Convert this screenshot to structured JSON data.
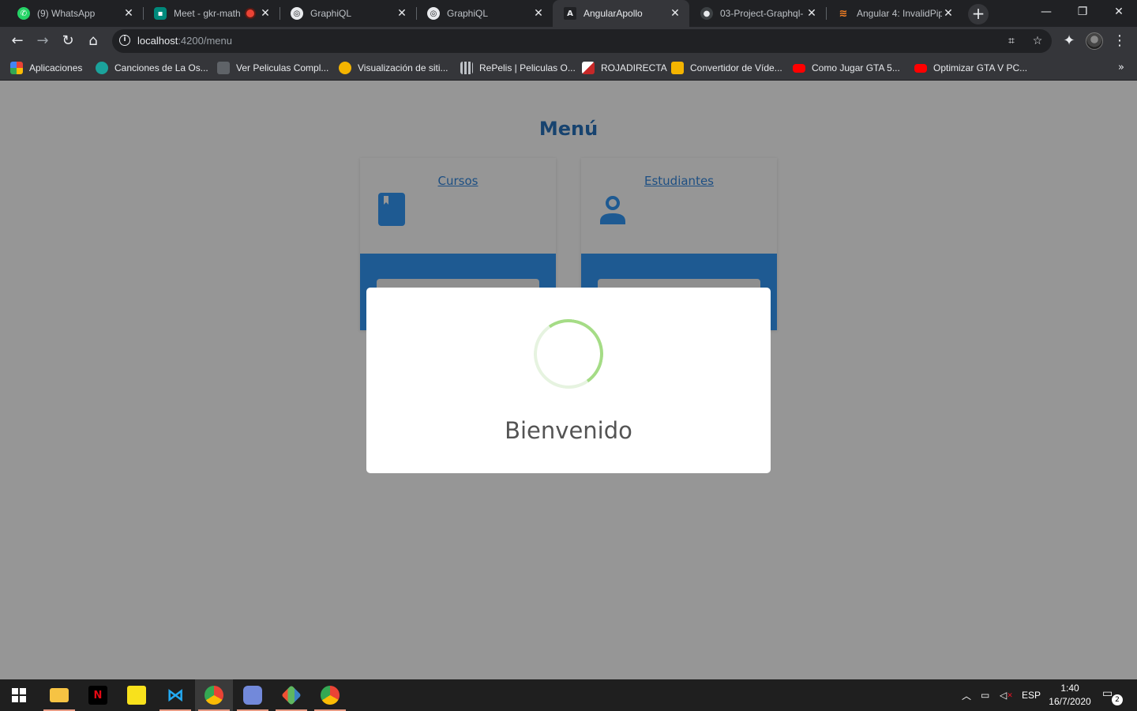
{
  "browser": {
    "tabs": [
      {
        "title": "(9) WhatsApp",
        "icon": "whatsapp-icon",
        "color": "#25d366"
      },
      {
        "title": "Meet - gkr-math",
        "icon": "meet-icon",
        "color": "#00897b"
      },
      {
        "title": "GraphiQL",
        "icon": "globe-icon",
        "color": "#e8eaed"
      },
      {
        "title": "GraphiQL",
        "icon": "globe-icon",
        "color": "#e8eaed"
      },
      {
        "title": "AngularApollo",
        "icon": "angular-icon",
        "color": "#e8eaed"
      },
      {
        "title": "03-Project-Graphql-",
        "icon": "github-icon",
        "color": "#e8eaed"
      },
      {
        "title": "Angular 4: InvalidPip",
        "icon": "stackoverflow-icon",
        "color": "#f48024"
      }
    ],
    "active_tab": 4,
    "url_host": "localhost",
    "url_path": ":4200/menu",
    "bookmarks": [
      {
        "label": "Aplicaciones",
        "icon": "apps-grid-icon"
      },
      {
        "label": "Canciones de La Os...",
        "icon": "music-icon"
      },
      {
        "label": "Ver Peliculas Compl...",
        "icon": "film-icon"
      },
      {
        "label": "Visualización de siti...",
        "icon": "smiley-icon"
      },
      {
        "label": "RePelis | Peliculas O...",
        "icon": "film-strip-icon"
      },
      {
        "label": "ROJADIRECTA",
        "icon": "rojadirecta-icon"
      },
      {
        "label": "Convertidor de Víde...",
        "icon": "camera-icon"
      },
      {
        "label": "Como Jugar GTA 5...",
        "icon": "youtube-icon"
      },
      {
        "label": "Optimizar GTA V PC...",
        "icon": "youtube-icon"
      }
    ]
  },
  "page": {
    "title": "Menú",
    "cards": [
      {
        "label": "Cursos",
        "icon": "book-icon"
      },
      {
        "label": "Estudiantes",
        "icon": "user-icon"
      }
    ]
  },
  "modal": {
    "title": "Bienvenido",
    "spinner": "loading-spinner"
  },
  "taskbar": {
    "language": "ESP",
    "time": "1:40",
    "date": "16/7/2020",
    "notifications": "2"
  },
  "colors": {
    "accent": "#1e5a92",
    "title": "#17436f",
    "spinner": "#a5dc86"
  }
}
